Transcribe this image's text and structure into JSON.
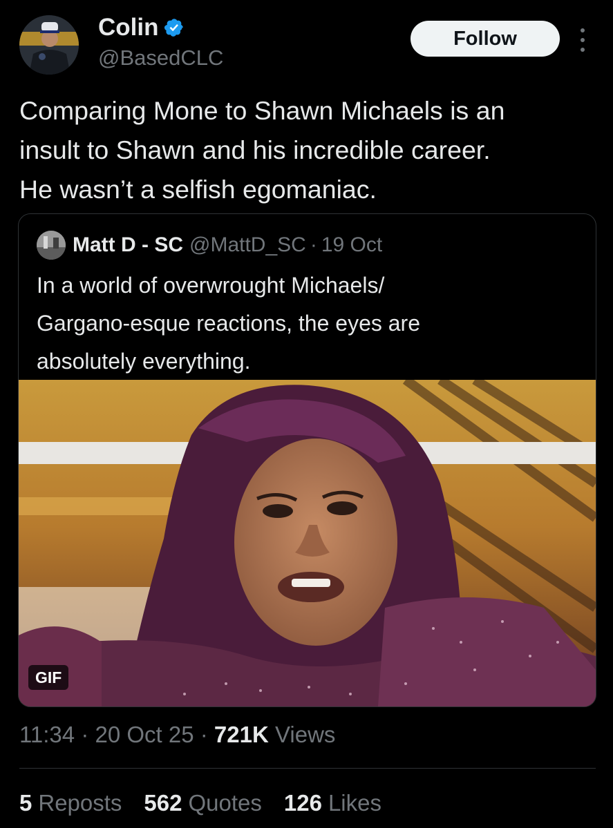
{
  "author": {
    "display_name": "Colin",
    "handle": "@BasedCLC",
    "verified": true,
    "verified_color": "#1d9bf0"
  },
  "follow_label": "Follow",
  "tweet_text": "Comparing Mone to Shawn Michaels is an\ninsult to Shawn and his incredible career.\nHe wasn’t a selfish egomaniac.",
  "quoted": {
    "name": "Matt D - SC",
    "handle": "@MattD_SC",
    "sep": "·",
    "date": "19 Oct",
    "text": "In a world of overwrought Michaels/\nGargano-esque reactions, the eyes are\nabsolutely everything.",
    "media_badge": "GIF"
  },
  "meta": {
    "time": "11:34",
    "sep": "·",
    "date": "20 Oct 25",
    "views_count": "721K",
    "views_label": "Views"
  },
  "stats": {
    "reposts_count": "5",
    "reposts_label": "Reposts",
    "quotes_count": "562",
    "quotes_label": "Quotes",
    "likes_count": "126",
    "likes_label": "Likes"
  },
  "icons": [
    "verified-badge-icon",
    "more-options-icon"
  ],
  "colors": {
    "background": "#000000",
    "text": "#e7e9ea",
    "muted": "#71767b",
    "follow_bg": "#eff3f4"
  }
}
